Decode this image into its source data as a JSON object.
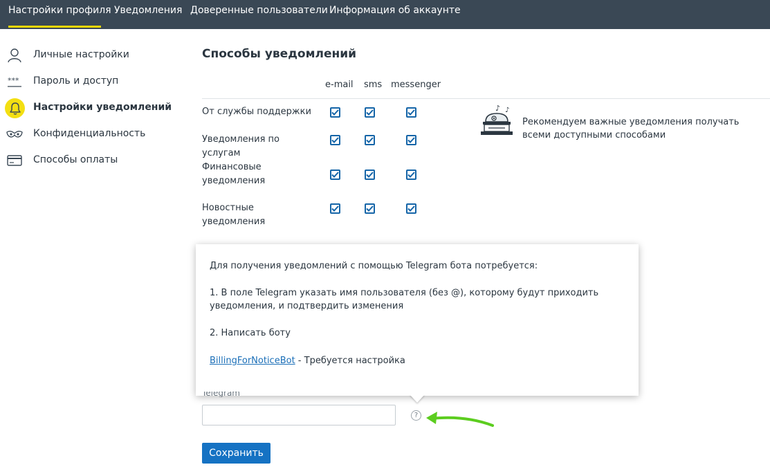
{
  "top_nav": {
    "tabs": [
      {
        "label": "Настройки профиля",
        "active": true
      },
      {
        "label": "Уведомления"
      },
      {
        "label": "Доверенные пользователи"
      },
      {
        "label": "Информация об аккаунте"
      }
    ],
    "active_underline_color": "#f1d800"
  },
  "sidebar": {
    "items": [
      {
        "label": "Личные настройки",
        "icon": "user-icon"
      },
      {
        "label": "Пароль и доступ",
        "icon": "password-icon",
        "glyph": "***"
      },
      {
        "label": "Настройки уведомлений",
        "icon": "bell-icon",
        "active": true
      },
      {
        "label": "Конфиденциальность",
        "icon": "mask-icon"
      },
      {
        "label": "Способы оплаты",
        "icon": "card-icon"
      }
    ]
  },
  "main": {
    "title": "Способы уведомлений",
    "columns": [
      "e-mail",
      "sms",
      "messenger"
    ],
    "rows": [
      {
        "label": "От службы поддержки",
        "email": true,
        "sms": true,
        "messenger": true
      },
      {
        "label": "Уведомления по услугам",
        "email": true,
        "sms": true,
        "messenger": true
      },
      {
        "label": "Финансовые уведомления",
        "email": true,
        "sms": true,
        "messenger": true
      },
      {
        "label": "Новостные уведомления",
        "email": true,
        "sms": true,
        "messenger": true
      }
    ],
    "recommendation": "Рекомендуем важные уведомления получать всеми доступными способами"
  },
  "popup": {
    "intro": "Для получения уведомлений с помощью Telegram бота потребуется:",
    "step1": "1. В поле Telegram указать имя пользователя (без @), которому будут приходить уведомления, и подтвердить изменения",
    "step2": "2. Написать боту",
    "bot_link": "BillingForNoticeBot",
    "bot_status": " - Требуется настройка"
  },
  "telegram": {
    "label": "Telegram",
    "value": "",
    "help_glyph": "?"
  },
  "save_button": "Сохранить",
  "colors": {
    "topbar": "#3a4855",
    "accent_yellow": "#f3df12",
    "checkbox": "#1565a8",
    "button": "#1572c3",
    "arrow": "#5ccd1f"
  }
}
